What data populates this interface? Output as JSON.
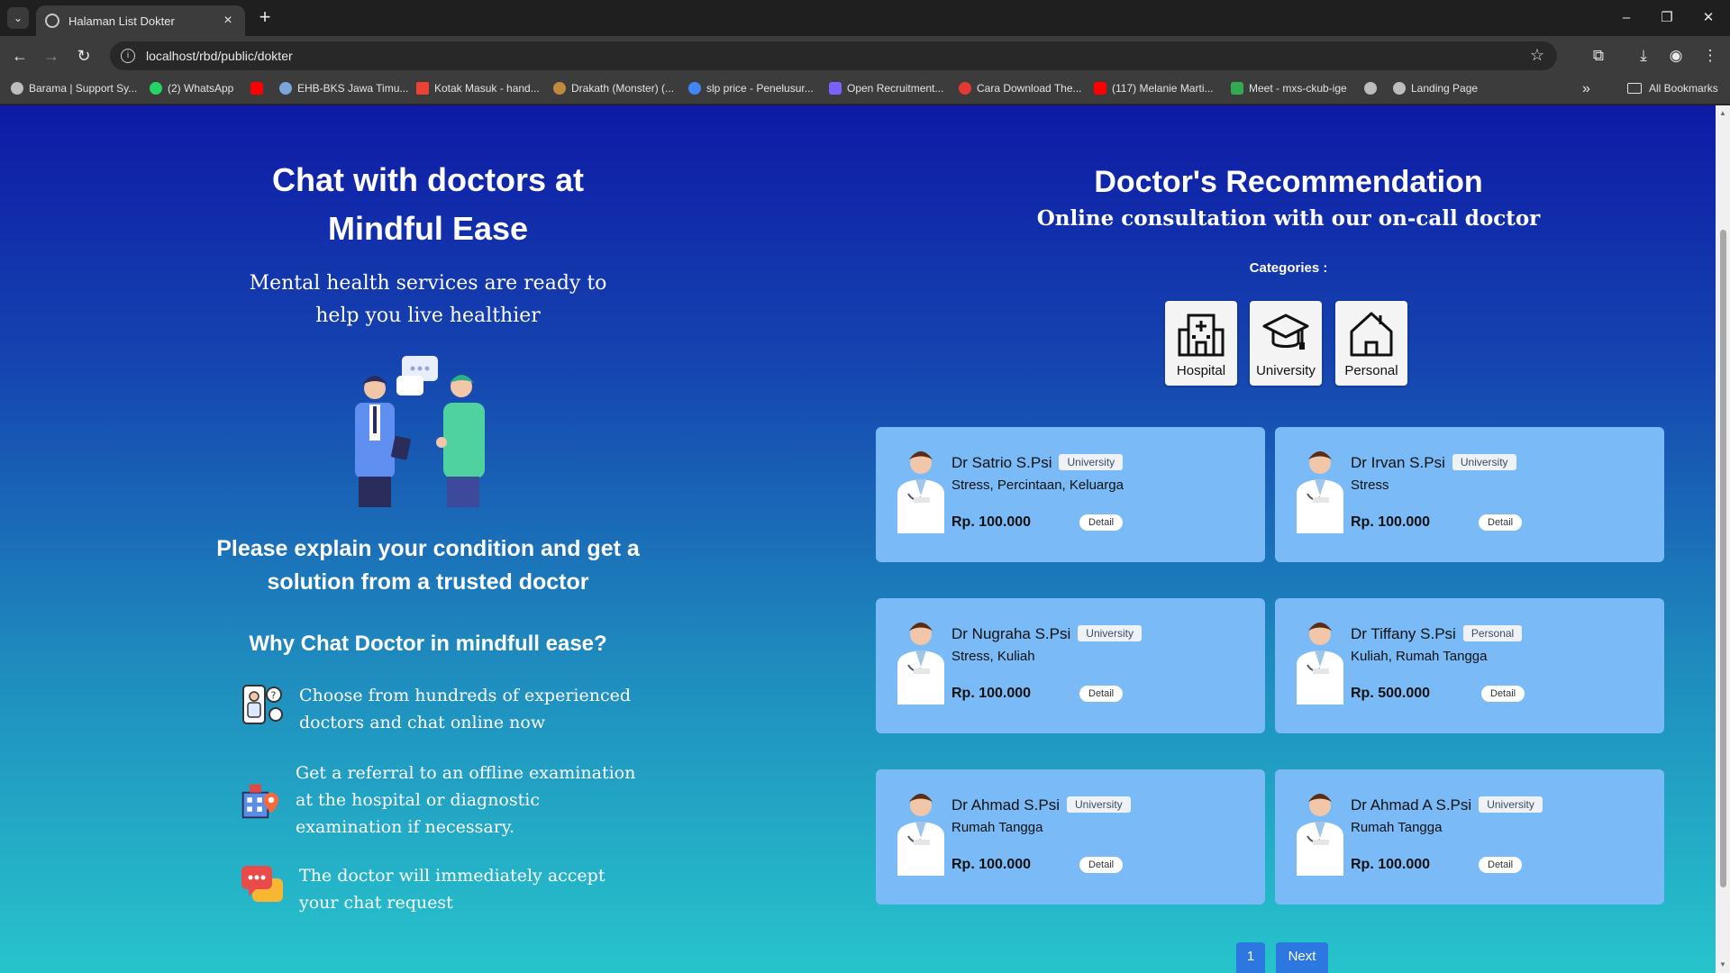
{
  "browser": {
    "tab_title": "Halaman List Dokter",
    "url": "localhost/rbd/public/dokter",
    "bookmarks": [
      {
        "label": "Barama | Support Sy...",
        "color": "#bdbdbd"
      },
      {
        "label": "(2) WhatsApp",
        "color": "#25d366"
      },
      {
        "label": "",
        "color": "#ff0000"
      },
      {
        "label": "EHB-BKS Jawa Timu...",
        "color": "#7aa6d8"
      },
      {
        "label": "Kotak Masuk - hand...",
        "color": "#ea4335"
      },
      {
        "label": "Drakath (Monster) (...",
        "color": "#c08a3e"
      },
      {
        "label": "slp price - Penelusur...",
        "color": "#4285f4"
      },
      {
        "label": "Open Recruitment...",
        "color": "#7b61ff"
      },
      {
        "label": "Cara Download The...",
        "color": "#e53935"
      },
      {
        "label": "(117) Melanie Marti...",
        "color": "#ff0000"
      },
      {
        "label": "Meet - mxs-ckub-ige",
        "color": "#34a853"
      },
      {
        "label": "",
        "color": "#bdbdbd"
      },
      {
        "label": "Landing Page",
        "color": "#bdbdbd"
      }
    ],
    "all_bookmarks": "All Bookmarks"
  },
  "left": {
    "title": "Chat with doctors at Mindful Ease",
    "subtitle": "Mental health services are ready to help you live healthier",
    "heading": "Please explain your condition and get a solution from a trusted doctor",
    "why": "Why Chat Doctor in mindfull ease?",
    "features": [
      "Choose from hundreds of experienced doctors and chat online now",
      "Get a referral to an offline examination at the hospital or diagnostic examination if necessary.",
      "The doctor will immediately accept your chat request"
    ]
  },
  "right": {
    "title": "Doctor's Recommendation",
    "subtitle": "Online consultation with our on-call doctor",
    "categories_label": "Categories :",
    "categories": [
      "Hospital",
      "University",
      "Personal"
    ],
    "detail_label": "Detail",
    "doctors": [
      {
        "name": "Dr Satrio S.Psi",
        "category": "University",
        "specialty": "Stress, Percintaan, Keluarga",
        "price": "Rp. 100.000"
      },
      {
        "name": "Dr Irvan S.Psi",
        "category": "University",
        "specialty": "Stress",
        "price": "Rp. 100.000"
      },
      {
        "name": "Dr Nugraha S.Psi",
        "category": "University",
        "specialty": "Stress, Kuliah",
        "price": "Rp. 100.000"
      },
      {
        "name": "Dr Tiffany S.Psi",
        "category": "Personal",
        "specialty": "Kuliah, Rumah Tangga",
        "price": "Rp. 500.000"
      },
      {
        "name": "Dr Ahmad S.Psi",
        "category": "University",
        "specialty": "Rumah Tangga",
        "price": "Rp. 100.000"
      },
      {
        "name": "Dr Ahmad A S.Psi",
        "category": "University",
        "specialty": "Rumah Tangga",
        "price": "Rp. 100.000"
      }
    ],
    "pagination": {
      "current": "1",
      "next": "Next"
    }
  }
}
